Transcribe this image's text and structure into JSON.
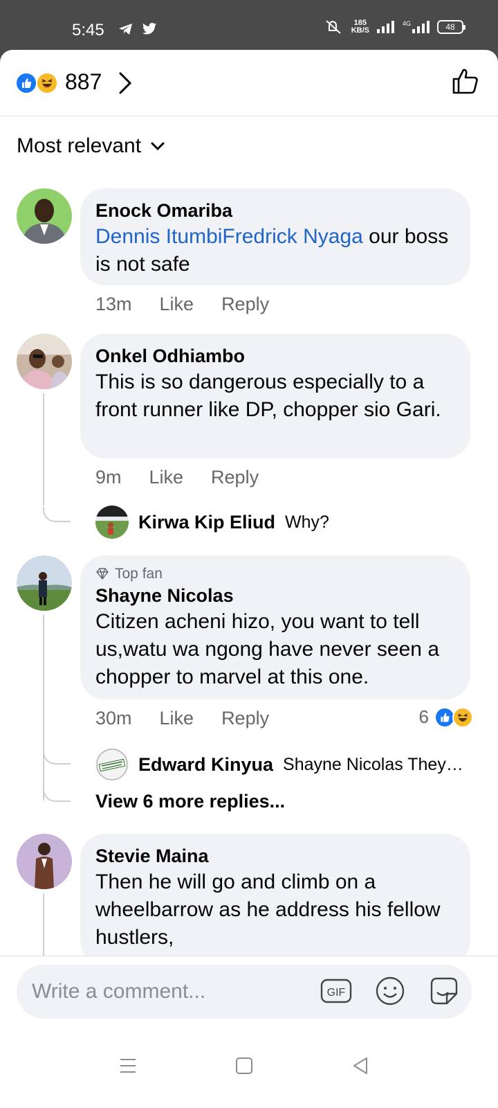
{
  "status_bar": {
    "time": "5:45",
    "net_speed_value": "185",
    "net_speed_unit": "KB/S",
    "network_label": "4G",
    "battery": "48"
  },
  "reactions_header": {
    "count": "887",
    "icons": [
      "like-icon",
      "haha-icon"
    ]
  },
  "sort": {
    "label": "Most relevant"
  },
  "comments": [
    {
      "author": "Enock Omariba",
      "mention": "Dennis ItumbiFredrick Nyaga",
      "text_after_mention": " our boss is not safe",
      "time": "13m",
      "like_label": "Like",
      "reply_label": "Reply"
    },
    {
      "author": "Onkel Odhiambo",
      "text": "This is so dangerous especially to a front runner like DP, chopper sio Gari.",
      "time": "9m",
      "like_label": "Like",
      "reply_label": "Reply",
      "replies": [
        {
          "author": "Kirwa Kip Eliud",
          "text": "Why?"
        }
      ]
    },
    {
      "badge": "Top fan",
      "author": "Shayne Nicolas",
      "text": "Citizen acheni hizo, you want to tell us,watu wa ngong have never seen a chopper to marvel at this one.",
      "time": "30m",
      "like_label": "Like",
      "reply_label": "Reply",
      "reaction_count": "6",
      "replies": [
        {
          "author": "Edward Kinyua",
          "text": "Shayne Nicolas They…",
          "avatar_text": "Profile pic CLOSED FOR RENOVATION"
        }
      ],
      "view_more": "View 6 more replies..."
    },
    {
      "author": "Stevie Maina",
      "text": "Then he will go and climb on a wheelbarrow as he address his fellow hustlers,"
    }
  ],
  "composer": {
    "placeholder": "Write a comment...",
    "gif_label": "GIF"
  },
  "colors": {
    "like_blue": "#1877f2",
    "haha_yellow": "#f7b928",
    "mention_blue": "#1f64c8",
    "bubble_bg": "#f0f2f5",
    "meta_gray": "#65676b"
  }
}
